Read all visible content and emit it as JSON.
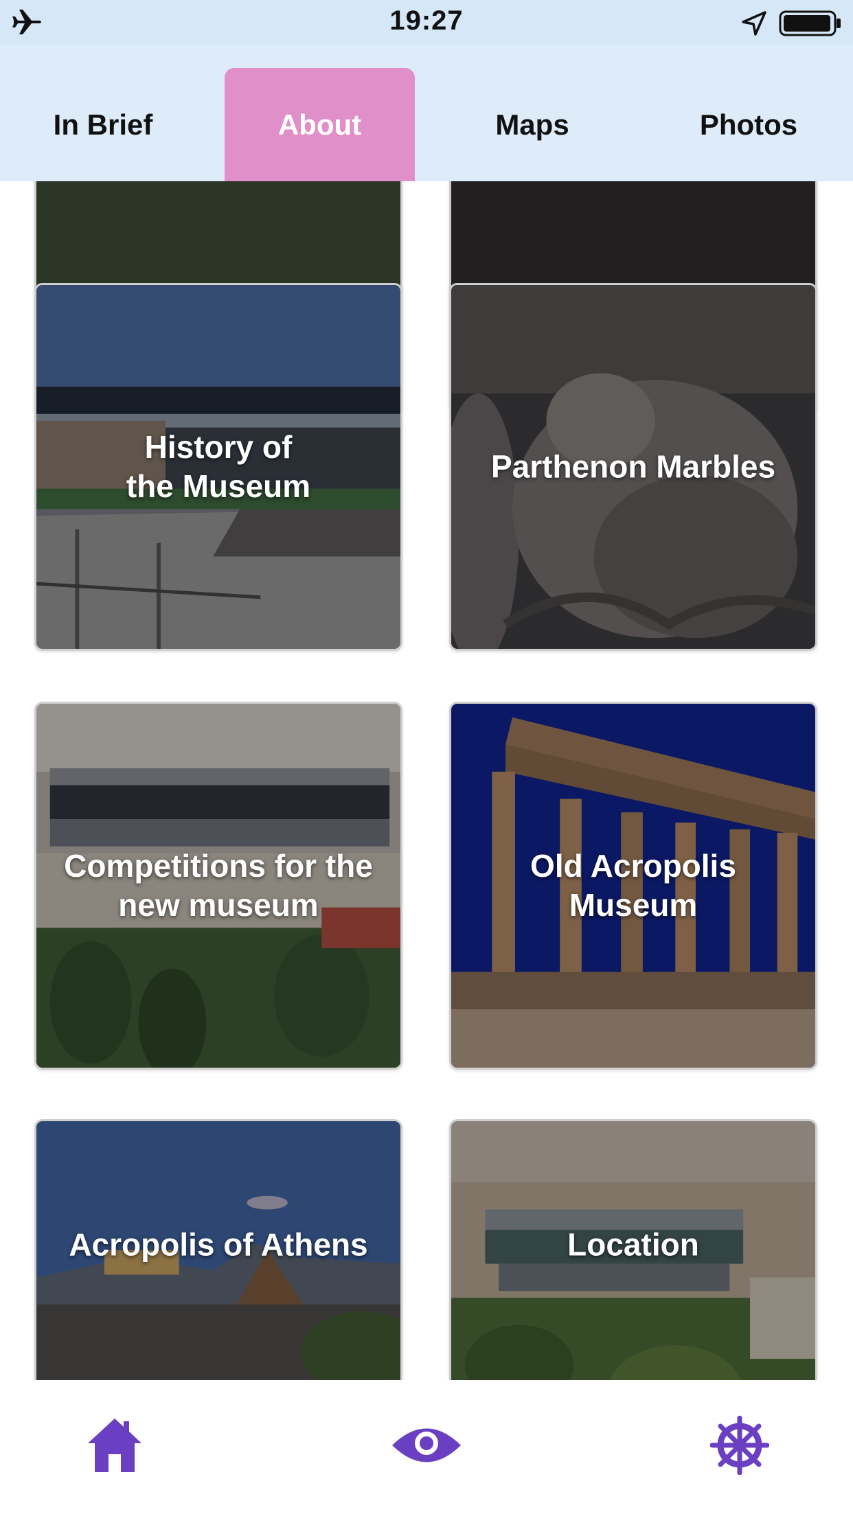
{
  "status_bar": {
    "time": "19:27",
    "icons": [
      "airplane-icon",
      "location-arrow-icon",
      "battery-icon"
    ]
  },
  "tabs": [
    {
      "label": "In Brief",
      "selected": false
    },
    {
      "label": "About",
      "selected": true
    },
    {
      "label": "Maps",
      "selected": false
    },
    {
      "label": "Photos",
      "selected": false
    }
  ],
  "cards": [
    {
      "label": "",
      "image": "woman-with-hat-photo"
    },
    {
      "label": "",
      "image": "museum-walkway-photo"
    },
    {
      "label": "History of\nthe Museum",
      "image": "museum-building-photo"
    },
    {
      "label": "Parthenon Marbles",
      "image": "marble-sculpture-photo"
    },
    {
      "label": "Competitions for the\nnew museum",
      "image": "city-aerial-photo"
    },
    {
      "label": "Old Acropolis\nMuseum",
      "image": "parthenon-columns-photo"
    },
    {
      "label": "Acropolis of Athens",
      "image": "acropolis-hill-photo"
    },
    {
      "label": "Location",
      "image": "museum-aerial-photo"
    }
  ],
  "bottom_nav": [
    {
      "icon": "home-icon"
    },
    {
      "icon": "eye-icon"
    },
    {
      "icon": "ship-wheel-icon"
    }
  ],
  "colors": {
    "accent_purple": "#6a3fc2",
    "tab_selected": "#e08fc8",
    "tab_bar_bg": "#deebf9",
    "status_bar_bg": "#d6e7f8"
  }
}
